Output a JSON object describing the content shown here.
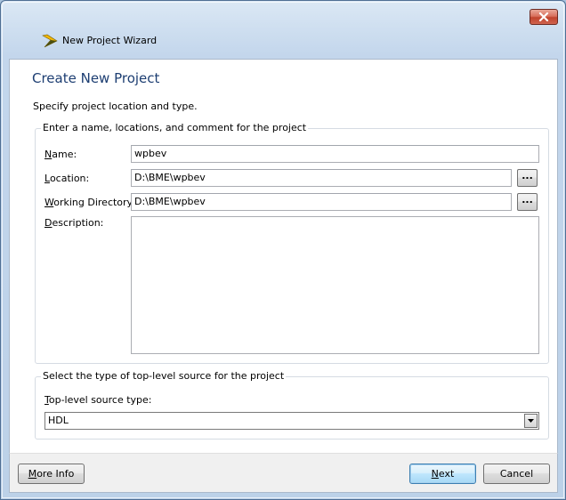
{
  "window": {
    "title": "New Project Wizard"
  },
  "page": {
    "title": "Create New Project",
    "subtitle": "Specify project location and type."
  },
  "project_group": {
    "legend": "Enter a name, locations, and comment for the project",
    "name_label_u": "N",
    "name_label_rest": "ame:",
    "name_value": "wpbev",
    "location_label_u": "L",
    "location_label_rest": "ocation:",
    "location_value": "D:\\BME\\wpbev",
    "workdir_label_u": "W",
    "workdir_label_rest": "orking Directory:",
    "workdir_value": "D:\\BME\\wpbev",
    "description_label_u": "D",
    "description_label_rest": "escription:",
    "browse_label": "..."
  },
  "source_group": {
    "legend": "Select the type of top-level source for the project",
    "type_label_u": "T",
    "type_label_rest": "op-level source type:",
    "selected": "HDL"
  },
  "footer": {
    "more_info_u": "M",
    "more_info_rest": "ore Info",
    "next_u": "N",
    "next_rest": "ext",
    "cancel": "Cancel"
  },
  "colors": {
    "title_blue": "#1d3e72",
    "close_red": "#c0432d",
    "default_button_border": "#3c7fb1"
  }
}
